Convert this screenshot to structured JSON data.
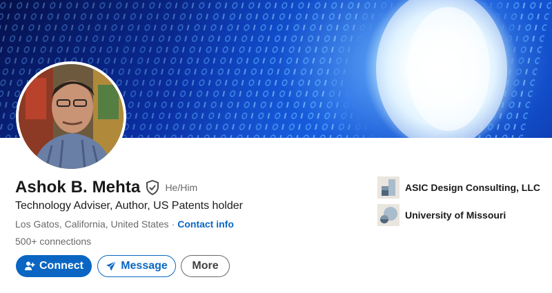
{
  "profile": {
    "name": "Ashok B. Mehta",
    "pronouns": "He/Him",
    "headline": "Technology Adviser, Author, US Patents holder",
    "location": "Los Gatos, California, United States",
    "separator": "·",
    "contact_label": "Contact info",
    "connections": "500+ connections"
  },
  "actions": {
    "connect_label": "Connect",
    "message_label": "Message",
    "more_label": "More"
  },
  "organizations": [
    {
      "name": "ASIC Design Consulting, LLC",
      "icon": "company-logo-icon"
    },
    {
      "name": "University of Missouri",
      "icon": "school-logo-icon"
    }
  ],
  "colors": {
    "brand_blue": "#0a66c2",
    "banner_dark": "#0a2fa3",
    "banner_light": "#bfe6ff"
  },
  "icons": {
    "verify": "verified-shield-icon",
    "connect": "add-person-icon",
    "message": "send-paper-plane-icon"
  }
}
